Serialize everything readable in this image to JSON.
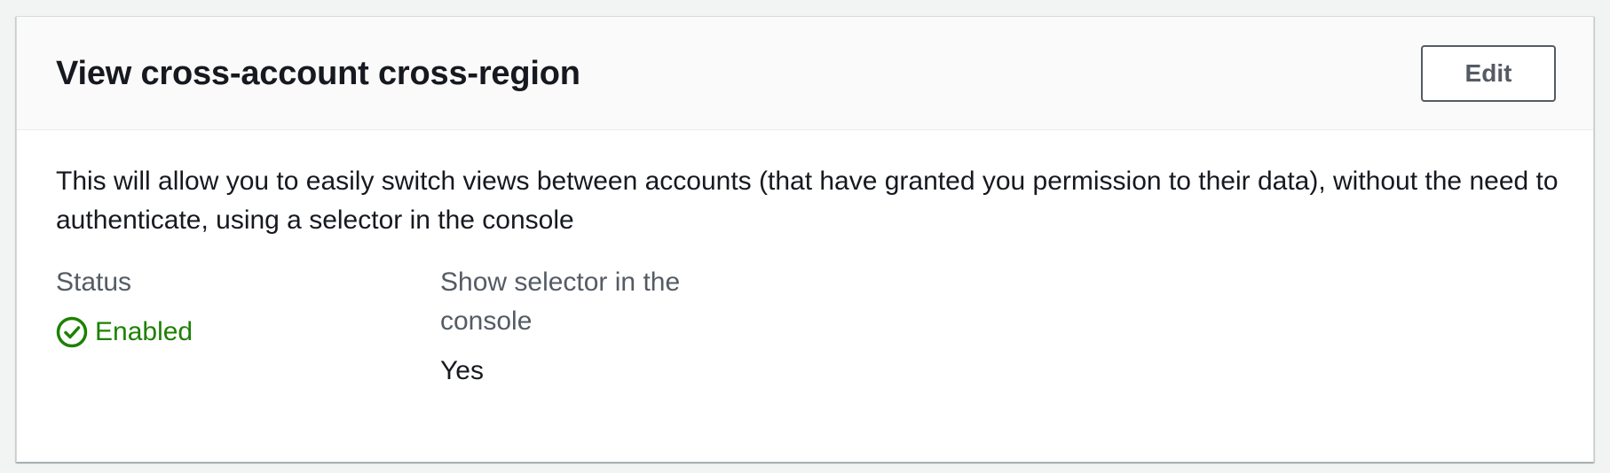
{
  "panel": {
    "title": "View cross-account cross-region",
    "edit_label": "Edit",
    "description": "This will allow you to easily switch views between accounts (that have granted you permission to their data), without the need to authenticate, using a selector in the console"
  },
  "fields": {
    "status": {
      "key": "Status",
      "value": "Enabled",
      "icon": "success-check-circle-icon",
      "color": "#1d8102"
    },
    "show_selector": {
      "key": "Show selector in the console",
      "value": "Yes"
    }
  }
}
